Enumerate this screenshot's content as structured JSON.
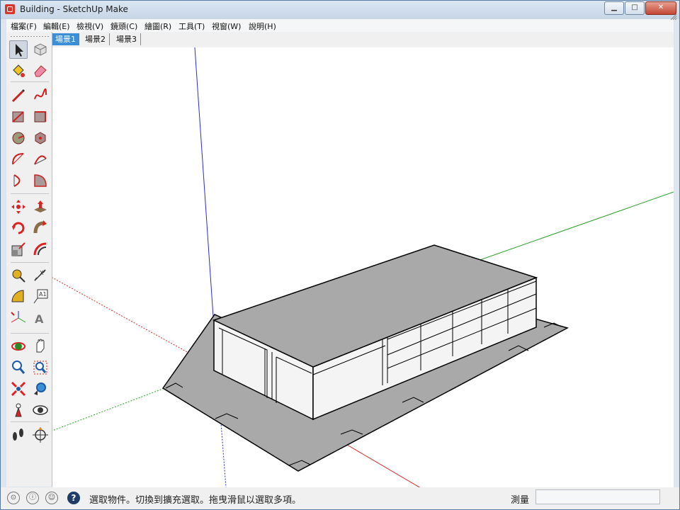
{
  "window": {
    "title": "Building - SketchUp Make"
  },
  "window_controls": {
    "minimize": "▁",
    "maximize": "□",
    "close": "✕"
  },
  "menu": [
    "檔案(F)",
    "編輯(E)",
    "檢視(V)",
    "鏡頭(C)",
    "繪圖(R)",
    "工具(T)",
    "視窗(W)",
    "說明(H)"
  ],
  "scenes": [
    {
      "label": "場景1",
      "active": true
    },
    {
      "label": "場景2",
      "active": false
    },
    {
      "label": "場景3",
      "active": false
    }
  ],
  "tools": [
    {
      "name": "select-tool-icon",
      "active": true
    },
    {
      "name": "make-component-icon"
    },
    {
      "name": "paint-bucket-icon"
    },
    {
      "name": "eraser-icon"
    },
    {
      "name": "line-pencil-icon"
    },
    {
      "name": "freehand-icon"
    },
    {
      "name": "rectangle-icon"
    },
    {
      "name": "rotated-rectangle-icon"
    },
    {
      "name": "circle-icon"
    },
    {
      "name": "polygon-icon"
    },
    {
      "name": "arc-icon"
    },
    {
      "name": "two-point-arc-icon"
    },
    {
      "name": "three-point-arc-icon"
    },
    {
      "name": "pie-icon"
    },
    {
      "name": "move-icon"
    },
    {
      "name": "push-pull-icon"
    },
    {
      "name": "rotate-icon"
    },
    {
      "name": "follow-me-icon"
    },
    {
      "name": "scale-icon"
    },
    {
      "name": "offset-icon"
    },
    {
      "name": "tape-measure-icon"
    },
    {
      "name": "dimension-icon"
    },
    {
      "name": "protractor-icon"
    },
    {
      "name": "text-icon"
    },
    {
      "name": "axes-icon"
    },
    {
      "name": "3d-text-icon"
    },
    {
      "name": "orbit-icon"
    },
    {
      "name": "pan-icon"
    },
    {
      "name": "zoom-icon"
    },
    {
      "name": "zoom-window-icon"
    },
    {
      "name": "zoom-extents-icon"
    },
    {
      "name": "previous-view-icon"
    },
    {
      "name": "position-camera-icon"
    },
    {
      "name": "look-around-icon"
    },
    {
      "name": "walk-icon"
    },
    {
      "name": "section-plane-icon"
    }
  ],
  "status": {
    "hint": "選取物件。切換到擴充選取。拖曳滑鼠以選取多項。",
    "measure_label": "測量",
    "measure_value": ""
  },
  "colors": {
    "x_axis": "#d62b2b",
    "y_axis": "#27a327",
    "z_axis": "#2b2bd6",
    "face": "#a9a9a9",
    "wall": "#f4f4f4",
    "selection_tab": "#3a8fd8"
  }
}
